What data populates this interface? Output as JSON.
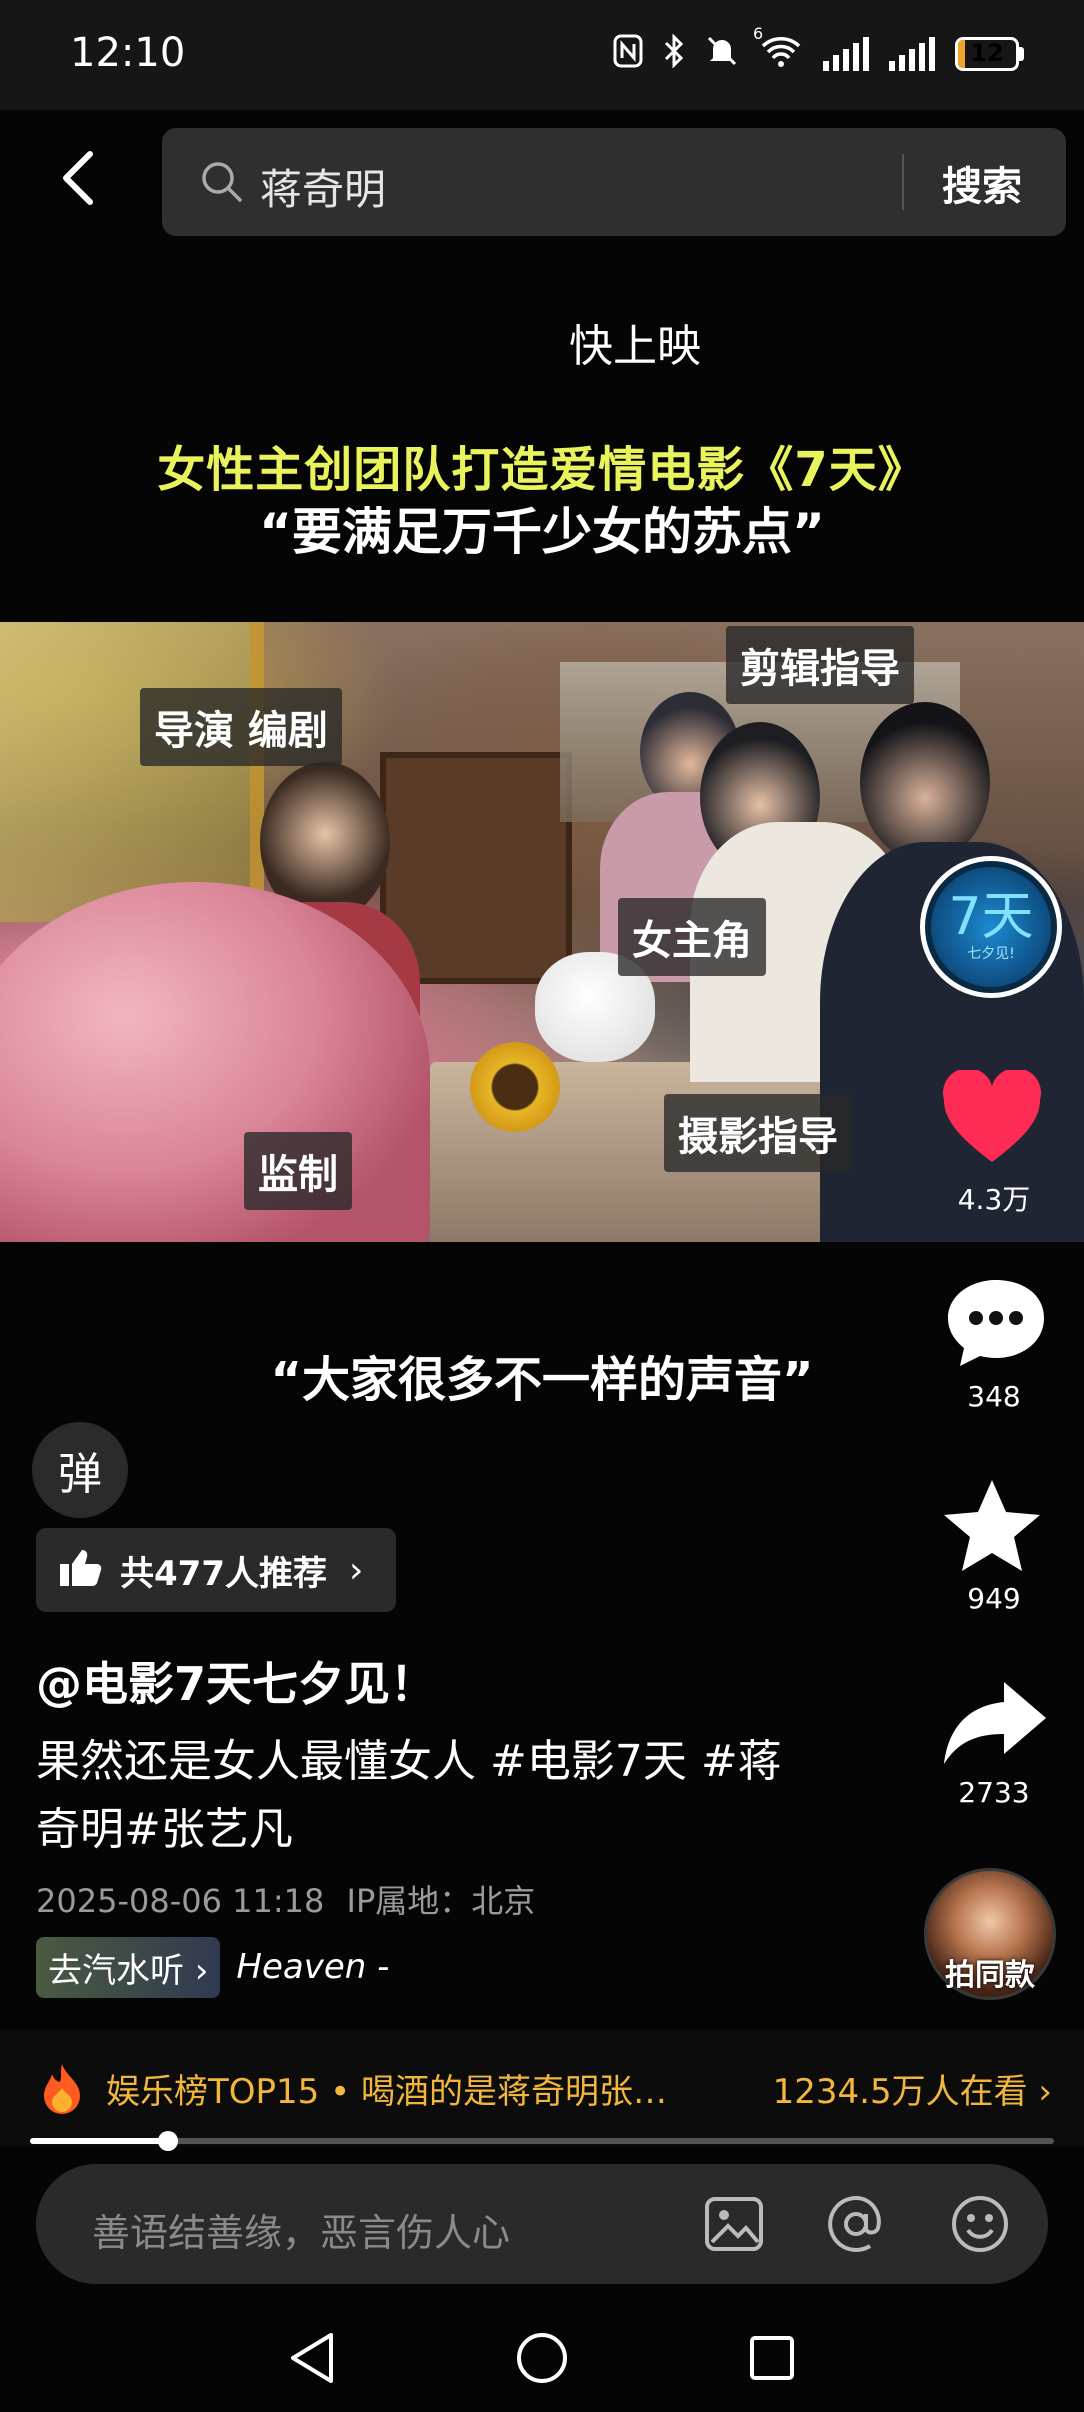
{
  "status_bar": {
    "time": "12:10",
    "battery_level": "12",
    "battery_fraction": 0.12,
    "icons": [
      "nfc-icon",
      "bluetooth-icon",
      "mute-icon",
      "wifi-icon",
      "signal-icon",
      "signal-icon",
      "battery-icon"
    ],
    "wifi_badge": "6"
  },
  "search": {
    "query": "蒋奇明",
    "button_label": "搜索"
  },
  "video": {
    "overlay_top": "快上映",
    "headline": "女性主创团队打造爱情电影《7天》",
    "subheadline": "“要满足万千少女的苏点”",
    "labels": {
      "director": "导演 编剧",
      "editing": "剪辑指导",
      "lead": "女主角",
      "supervisor": "监制",
      "cinematography": "摄影指导"
    },
    "quote": "“大家很多不一样的声音”",
    "progress_fraction": 0.135
  },
  "rail": {
    "avatar_text": "7天",
    "avatar_sub": "七夕见!",
    "likes": "4.3万",
    "comments": "348",
    "favorites": "949",
    "shares": "2733",
    "same_style": "拍同款"
  },
  "post": {
    "danmu": "弹",
    "recommend": "共477人推荐",
    "author": "@电影7天七夕见！",
    "caption": "果然还是女人最懂女人 #电影7天  #蒋奇明#张艺凡",
    "date": "2025-08-06 11:18",
    "ip": "IP属地：北京",
    "music_chip": "去汽水听",
    "music_name": "Heaven -"
  },
  "trending": {
    "text": "娱乐榜TOP15 • 喝酒的是蒋奇明张…",
    "count": "1234.5万人在看"
  },
  "comment": {
    "placeholder": "善语结善缘，恶言伤人心"
  },
  "colors": {
    "like": "#fe2c55",
    "trend": "#f3b63d",
    "headline": "#e9f35c"
  }
}
